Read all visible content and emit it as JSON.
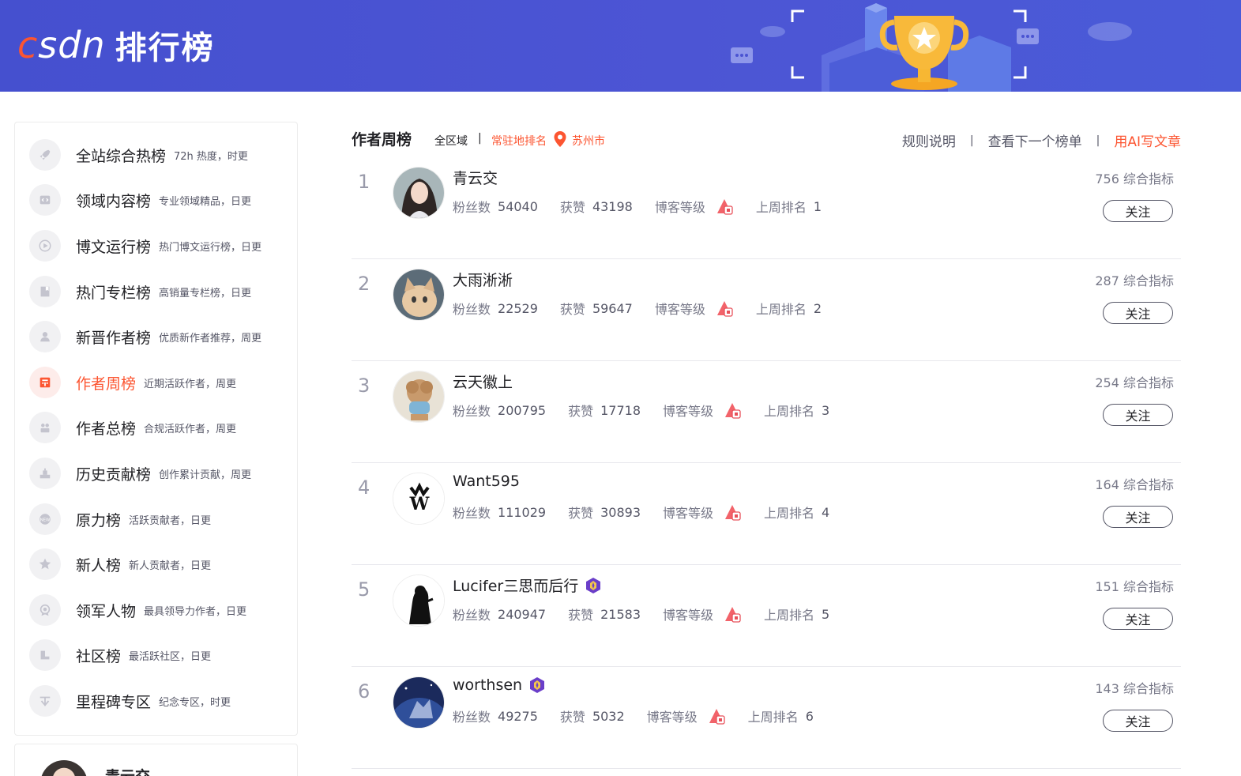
{
  "header": {
    "logo_text_c": "c",
    "logo_text_rest": "sdn",
    "title": "排行榜"
  },
  "sidebar": {
    "items": [
      {
        "name": "全站综合热榜",
        "desc": "72h 热度，时更",
        "icon": "rocket-icon"
      },
      {
        "name": "领域内容榜",
        "desc": "专业领域精品，日更",
        "icon": "code-icon"
      },
      {
        "name": "博文运行榜",
        "desc": "热门博文运行榜，日更",
        "icon": "play-icon"
      },
      {
        "name": "热门专栏榜",
        "desc": "高销量专栏榜，日更",
        "icon": "bookmark-icon"
      },
      {
        "name": "新晋作者榜",
        "desc": "优质新作者推荐，周更",
        "icon": "user-icon"
      },
      {
        "name": "作者周榜",
        "desc": "近期活跃作者，周更",
        "icon": "calendar-icon"
      },
      {
        "name": "作者总榜",
        "desc": "合规活跃作者，周更",
        "icon": "users-icon"
      },
      {
        "name": "历史贡献榜",
        "desc": "创作累计贡献，周更",
        "icon": "trophy-icon"
      },
      {
        "name": "原力榜",
        "desc": "活跃贡献者，日更",
        "icon": "new-badge-icon"
      },
      {
        "name": "新人榜",
        "desc": "新人贡献者，日更",
        "icon": "star-badge-icon"
      },
      {
        "name": "领军人物",
        "desc": "最具领导力作者，日更",
        "icon": "medal-icon"
      },
      {
        "name": "社区榜",
        "desc": "最活跃社区，日更",
        "icon": "community-icon"
      },
      {
        "name": "里程碑专区",
        "desc": "纪念专区，时更",
        "icon": "milestone-icon"
      }
    ],
    "active_index": 5,
    "user_card_name": "青云交"
  },
  "list": {
    "title": "作者周榜",
    "scope": "全区域",
    "separator": "|",
    "resident_label": "常驻地排名",
    "city": "苏州市",
    "links": {
      "rules": "规则说明",
      "next": "查看下一个榜单",
      "ai": "用AI写文章"
    },
    "labels": {
      "fans": "粉丝数",
      "likes": "获赞",
      "level": "博客等级",
      "last_week": "上周排名",
      "follow": "关注"
    },
    "rows": [
      {
        "rank": "1",
        "name": "青云交",
        "fans": "54040",
        "likes": "43198",
        "last_week": "1",
        "score": "756 综合指标",
        "badge": false
      },
      {
        "rank": "2",
        "name": "大雨淅淅",
        "fans": "22529",
        "likes": "59647",
        "last_week": "2",
        "score": "287 综合指标",
        "badge": false
      },
      {
        "rank": "3",
        "name": "云天徽上",
        "fans": "200795",
        "likes": "17718",
        "last_week": "3",
        "score": "254 综合指标",
        "badge": false
      },
      {
        "rank": "4",
        "name": "Want595",
        "fans": "111029",
        "likes": "30893",
        "last_week": "4",
        "score": "164 综合指标",
        "badge": false
      },
      {
        "rank": "5",
        "name": "Lucifer三思而后行",
        "fans": "240947",
        "likes": "21583",
        "last_week": "5",
        "score": "151 综合指标",
        "badge": true
      },
      {
        "rank": "6",
        "name": "worthsen",
        "fans": "49275",
        "likes": "5032",
        "last_week": "6",
        "score": "143 综合指标",
        "badge": true
      }
    ]
  },
  "colors": {
    "brand": "#fc5531",
    "banner": "#4a53d2"
  }
}
